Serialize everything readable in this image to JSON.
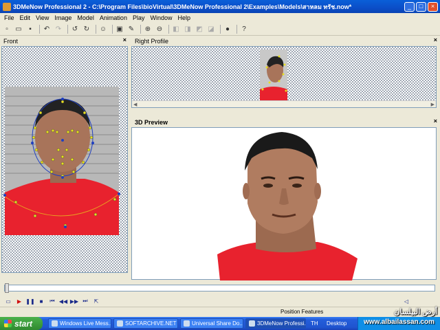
{
  "window": {
    "title": "3DMeNow Professional 2 - C:\\Program Files\\bioVirtual\\3DMeNow Professional 2\\Examples\\Models\\สาหลม ทรัช.now*"
  },
  "menu": [
    "File",
    "Edit",
    "View",
    "Image",
    "Model",
    "Animation",
    "Play",
    "Window",
    "Help"
  ],
  "toolbar_icons": [
    "new-icon",
    "open-icon",
    "save-icon",
    "undo-icon",
    "redo-icon",
    "rotate-left-icon",
    "rotate-right-icon",
    "person-icon",
    "camera-icon",
    "wand-icon",
    "zoom-in-icon",
    "zoom-out-icon",
    "view-1-icon",
    "view-2-icon",
    "view-3-icon",
    "view-4-icon",
    "globe-icon",
    "help-icon"
  ],
  "panes": {
    "front": {
      "title": "Front"
    },
    "right": {
      "title": "Right Profile"
    },
    "preview": {
      "title": "3D Preview"
    }
  },
  "status": {
    "text": "Position Features"
  },
  "taskbar": {
    "start": "start",
    "tasks": [
      "Windows Live Mess...",
      "SOFTARCHIVE.NET ...",
      "Universal Share Do...",
      "3DMeNow Professi..."
    ],
    "tray_lang": "TH",
    "tray_desktop": "Desktop"
  },
  "watermark": {
    "arabic": "أرض البيلسان",
    "url": "www.albailassan.com"
  },
  "colors": {
    "title_blue": "#0b4ec8",
    "shirt_red": "#e8222e",
    "feature_yellow": "#e8e020",
    "feature_blue": "#2040c0"
  }
}
